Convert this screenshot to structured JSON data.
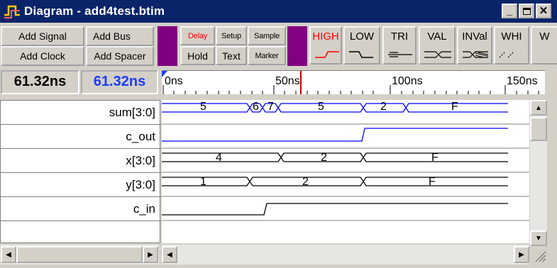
{
  "window": {
    "title": "Diagram - add4test.btim"
  },
  "toolbar": {
    "add_signal": "Add Signal",
    "add_bus": "Add Bus",
    "add_clock": "Add Clock",
    "add_spacer": "Add Spacer",
    "delay": "Delay",
    "setup": "Setup",
    "sample": "Sample",
    "hold": "Hold",
    "text": "Text",
    "marker": "Marker",
    "high": "HIGH",
    "low": "LOW",
    "tri": "TRI",
    "val": "VAL",
    "inval": "INVal",
    "whi": "WHI",
    "w_partial": "W"
  },
  "times": {
    "cursor1": "61.32ns",
    "cursor2": "61.32ns"
  },
  "ruler": {
    "ticks": [
      "0ns",
      "50ns",
      "100ns",
      "150ns"
    ]
  },
  "signals": [
    {
      "name": "sum[3:0]",
      "type": "bus",
      "values": [
        "5",
        "6",
        "7",
        "5",
        "2",
        "F"
      ]
    },
    {
      "name": "c_out",
      "type": "bit",
      "values": []
    },
    {
      "name": "x[3:0]",
      "type": "bus",
      "values": [
        "4",
        "2",
        "F"
      ]
    },
    {
      "name": "y[3:0]",
      "type": "bus",
      "values": [
        "1",
        "2",
        "F"
      ]
    },
    {
      "name": "c_in",
      "type": "bit",
      "values": []
    }
  ],
  "colors": {
    "accent_purple": "#800080",
    "blue_signal": "#0000ff",
    "marker_red": "#cc0000",
    "titlebar": "#0a246a"
  },
  "icons": [
    "diagram-app-icon",
    "minimize-icon",
    "maximize-icon",
    "close-icon",
    "scroll-up-icon",
    "scroll-down-icon",
    "scroll-left-icon",
    "scroll-right-icon",
    "size-grip-icon"
  ]
}
